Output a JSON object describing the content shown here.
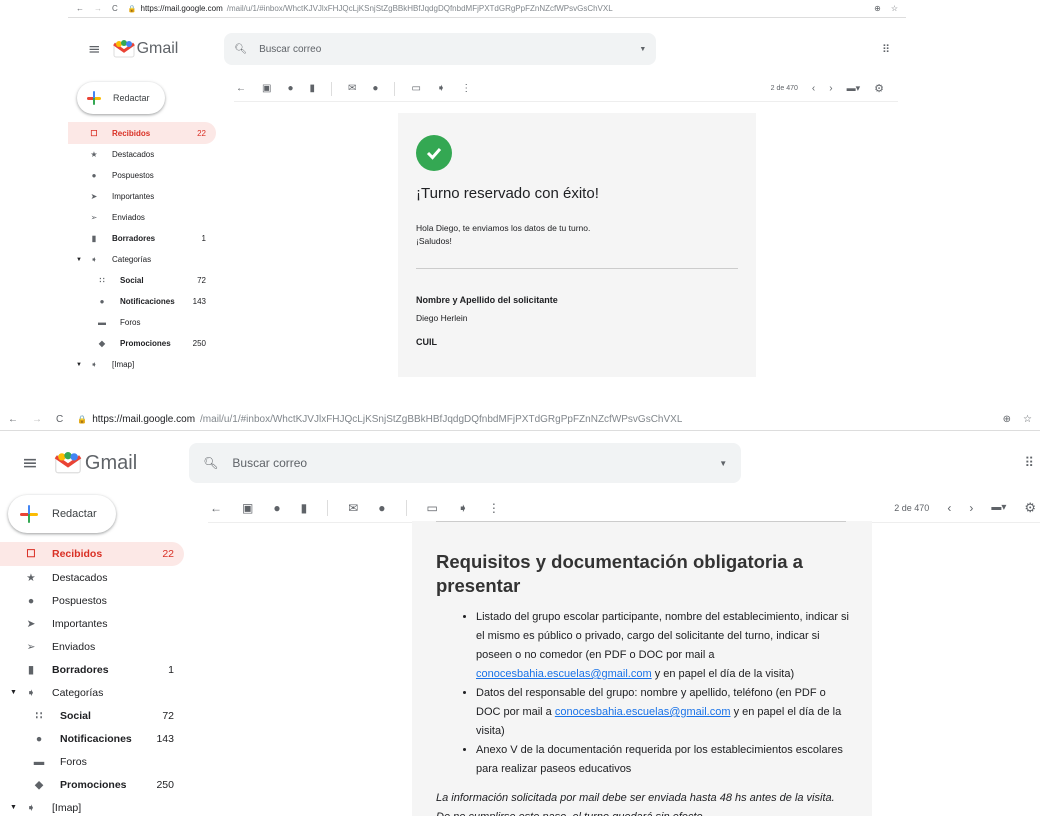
{
  "browser": {
    "url_host": "https://mail.google.com",
    "url_path": "/mail/u/1/#inbox/WhctKJVJlxFHJQcLjKSnjStZgBBkHBfJqdgDQfnbdMFjPXTdGRgPpFZnNZcfWPsvGsChVXL"
  },
  "app": {
    "logo_text": "Gmail",
    "search_placeholder": "Buscar correo",
    "compose_label": "Redactar"
  },
  "sidebar": {
    "items": [
      {
        "label": "Recibidos",
        "count": "22",
        "icon": "inbox-icon"
      },
      {
        "label": "Destacados",
        "count": "",
        "icon": "star-icon"
      },
      {
        "label": "Pospuestos",
        "count": "",
        "icon": "clock-icon"
      },
      {
        "label": "Importantes",
        "count": "",
        "icon": "important-icon"
      },
      {
        "label": "Enviados",
        "count": "",
        "icon": "send-icon"
      },
      {
        "label": "Borradores",
        "count": "1",
        "icon": "draft-icon"
      },
      {
        "label": "Categorías",
        "count": "",
        "icon": "label-icon"
      },
      {
        "label": "Social",
        "count": "72",
        "icon": "people-icon"
      },
      {
        "label": "Notificaciones",
        "count": "143",
        "icon": "info-icon"
      },
      {
        "label": "Foros",
        "count": "",
        "icon": "forum-icon"
      },
      {
        "label": "Promociones",
        "count": "250",
        "icon": "tag-icon"
      },
      {
        "label": "[Imap]",
        "count": "",
        "icon": "label-icon"
      }
    ]
  },
  "toolbar": {
    "pagination": "2 de 470"
  },
  "email_top": {
    "title": "¡Turno reservado con éxito!",
    "greeting": "Hola Diego, te enviamos los datos de tu turno.",
    "salute": "¡Saludos!",
    "field1_label": "Nombre y Apellido del solicitante",
    "field1_value": "Diego Herlein",
    "field2_label": "CUIL"
  },
  "email_bottom": {
    "heading": "Requisitos y documentación obligatoria a presentar",
    "b1_a": "Listado del grupo escolar participante, nombre del establecimiento, indicar si el mismo es público o privado, cargo del solicitante del turno, indicar si poseen o no comedor (en PDF o DOC por mail a ",
    "b1_link": "conocesbahia.escuelas@gmail.com",
    "b1_b": " y en papel el día de la visita)",
    "b2_a": "Datos del responsable del grupo: nombre y apellido, teléfono (en PDF o DOC por mail a ",
    "b2_link": "conocesbahia.escuelas@gmail.com",
    "b2_b": " y en papel el día de la visita)",
    "b3": "Anexo V de la documentación requerida por los establecimientos escolares para realizar paseos educativos",
    "note": "La información solicitada por mail debe ser enviada hasta 48 hs antes de la visita. De no cumplirse este paso, el turno quedará sin efecto."
  },
  "colors": {
    "active_bg": "#fce8e6",
    "active_fg": "#d93025",
    "check_green": "#34a853",
    "link": "#1a73e8"
  }
}
